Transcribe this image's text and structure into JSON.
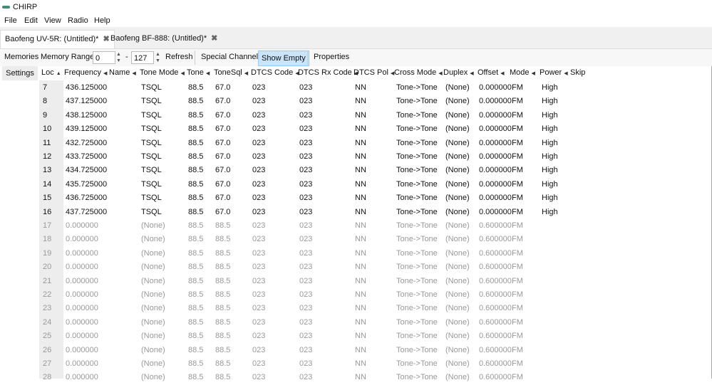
{
  "window": {
    "title": "CHIRP"
  },
  "menu": [
    "File",
    "Edit",
    "View",
    "Radio",
    "Help"
  ],
  "tabs": [
    {
      "label": "Baofeng UV-5R: (Untitled)*",
      "close": "✖"
    },
    {
      "label": "Baofeng BF-888: (Untitled)*",
      "close": "✖"
    }
  ],
  "toolbar": {
    "memories": "Memories",
    "range_label": "Memory Range:",
    "range_from": "0",
    "dash": "-",
    "range_to": "127",
    "refresh": "Refresh",
    "special": "Special Channels",
    "show_empty": "Show Empty",
    "properties": "Properties",
    "settings": "Settings"
  },
  "columns": [
    {
      "label": "Loc",
      "sort": "▲"
    },
    {
      "label": "Frequency",
      "sort": "◀"
    },
    {
      "label": "Name",
      "sort": "◀"
    },
    {
      "label": "Tone Mode",
      "sort": "◀"
    },
    {
      "label": "Tone",
      "sort": "◀"
    },
    {
      "label": "ToneSql",
      "sort": "◀"
    },
    {
      "label": "DTCS Code",
      "sort": "◀"
    },
    {
      "label": "DTCS Rx Code",
      "sort": "◀"
    },
    {
      "label": "DTCS Pol",
      "sort": "◀"
    },
    {
      "label": "Cross Mode",
      "sort": "◀"
    },
    {
      "label": "Duplex",
      "sort": "◀"
    },
    {
      "label": "Offset",
      "sort": "◀"
    },
    {
      "label": "Mode",
      "sort": "◀"
    },
    {
      "label": "Power",
      "sort": "◀"
    },
    {
      "label": "Skip",
      "sort": ""
    }
  ],
  "rows": [
    [
      "7",
      "436.125000",
      "",
      "TSQL",
      "88.5",
      "67.0",
      "023",
      "023",
      "NN",
      "Tone->Tone",
      "(None)",
      "0.000000",
      "FM",
      "High",
      ""
    ],
    [
      "8",
      "437.125000",
      "",
      "TSQL",
      "88.5",
      "67.0",
      "023",
      "023",
      "NN",
      "Tone->Tone",
      "(None)",
      "0.000000",
      "FM",
      "High",
      ""
    ],
    [
      "9",
      "438.125000",
      "",
      "TSQL",
      "88.5",
      "67.0",
      "023",
      "023",
      "NN",
      "Tone->Tone",
      "(None)",
      "0.000000",
      "FM",
      "High",
      ""
    ],
    [
      "10",
      "439.125000",
      "",
      "TSQL",
      "88.5",
      "67.0",
      "023",
      "023",
      "NN",
      "Tone->Tone",
      "(None)",
      "0.000000",
      "FM",
      "High",
      ""
    ],
    [
      "11",
      "432.725000",
      "",
      "TSQL",
      "88.5",
      "67.0",
      "023",
      "023",
      "NN",
      "Tone->Tone",
      "(None)",
      "0.000000",
      "FM",
      "High",
      ""
    ],
    [
      "12",
      "433.725000",
      "",
      "TSQL",
      "88.5",
      "67.0",
      "023",
      "023",
      "NN",
      "Tone->Tone",
      "(None)",
      "0.000000",
      "FM",
      "High",
      ""
    ],
    [
      "13",
      "434.725000",
      "",
      "TSQL",
      "88.5",
      "67.0",
      "023",
      "023",
      "NN",
      "Tone->Tone",
      "(None)",
      "0.000000",
      "FM",
      "High",
      ""
    ],
    [
      "14",
      "435.725000",
      "",
      "TSQL",
      "88.5",
      "67.0",
      "023",
      "023",
      "NN",
      "Tone->Tone",
      "(None)",
      "0.000000",
      "FM",
      "High",
      ""
    ],
    [
      "15",
      "436.725000",
      "",
      "TSQL",
      "88.5",
      "67.0",
      "023",
      "023",
      "NN",
      "Tone->Tone",
      "(None)",
      "0.000000",
      "FM",
      "High",
      ""
    ],
    [
      "16",
      "437.725000",
      "",
      "TSQL",
      "88.5",
      "67.0",
      "023",
      "023",
      "NN",
      "Tone->Tone",
      "(None)",
      "0.000000",
      "FM",
      "High",
      ""
    ],
    [
      "17",
      "0.000000",
      "",
      "(None)",
      "88.5",
      "88.5",
      "023",
      "023",
      "NN",
      "Tone->Tone",
      "(None)",
      "0.600000",
      "FM",
      "",
      ""
    ],
    [
      "18",
      "0.000000",
      "",
      "(None)",
      "88.5",
      "88.5",
      "023",
      "023",
      "NN",
      "Tone->Tone",
      "(None)",
      "0.600000",
      "FM",
      "",
      ""
    ],
    [
      "19",
      "0.000000",
      "",
      "(None)",
      "88.5",
      "88.5",
      "023",
      "023",
      "NN",
      "Tone->Tone",
      "(None)",
      "0.600000",
      "FM",
      "",
      ""
    ],
    [
      "20",
      "0.000000",
      "",
      "(None)",
      "88.5",
      "88.5",
      "023",
      "023",
      "NN",
      "Tone->Tone",
      "(None)",
      "0.600000",
      "FM",
      "",
      ""
    ],
    [
      "21",
      "0.000000",
      "",
      "(None)",
      "88.5",
      "88.5",
      "023",
      "023",
      "NN",
      "Tone->Tone",
      "(None)",
      "0.600000",
      "FM",
      "",
      ""
    ],
    [
      "22",
      "0.000000",
      "",
      "(None)",
      "88.5",
      "88.5",
      "023",
      "023",
      "NN",
      "Tone->Tone",
      "(None)",
      "0.600000",
      "FM",
      "",
      ""
    ],
    [
      "23",
      "0.000000",
      "",
      "(None)",
      "88.5",
      "88.5",
      "023",
      "023",
      "NN",
      "Tone->Tone",
      "(None)",
      "0.600000",
      "FM",
      "",
      ""
    ],
    [
      "24",
      "0.000000",
      "",
      "(None)",
      "88.5",
      "88.5",
      "023",
      "023",
      "NN",
      "Tone->Tone",
      "(None)",
      "0.600000",
      "FM",
      "",
      ""
    ],
    [
      "25",
      "0.000000",
      "",
      "(None)",
      "88.5",
      "88.5",
      "023",
      "023",
      "NN",
      "Tone->Tone",
      "(None)",
      "0.600000",
      "FM",
      "",
      ""
    ],
    [
      "26",
      "0.000000",
      "",
      "(None)",
      "88.5",
      "88.5",
      "023",
      "023",
      "NN",
      "Tone->Tone",
      "(None)",
      "0.600000",
      "FM",
      "",
      ""
    ],
    [
      "27",
      "0.000000",
      "",
      "(None)",
      "88.5",
      "88.5",
      "023",
      "023",
      "NN",
      "Tone->Tone",
      "(None)",
      "0.600000",
      "FM",
      "",
      ""
    ],
    [
      "28",
      "0.000000",
      "",
      "(None)",
      "88.5",
      "88.5",
      "023",
      "023",
      "NN",
      "Tone->Tone",
      "(None)",
      "0.600000",
      "FM",
      "",
      ""
    ]
  ],
  "empty_from_row": 10
}
